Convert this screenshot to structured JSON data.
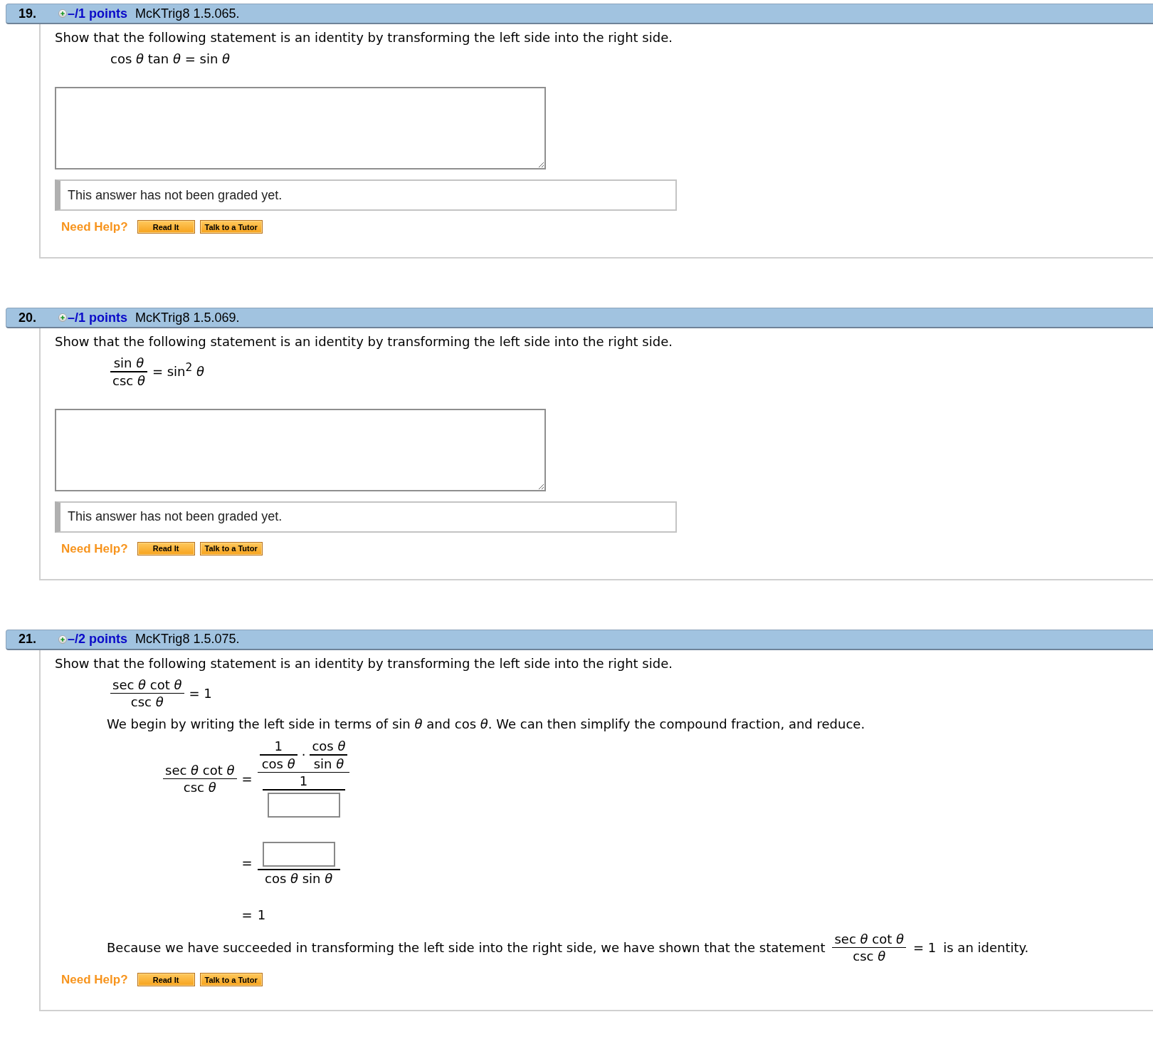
{
  "questions": [
    {
      "number": "19.",
      "points": "–/1 points",
      "source": "McKTrig8 1.5.065.",
      "prompt": "Show that the following statement is an identity by transforming the left side into the right side.",
      "statement": [
        {
          "kind": "text",
          "text": "cos *θ* tan *θ* = sin *θ*"
        }
      ],
      "answer": {
        "kind": "essay"
      },
      "grading_note": "This answer has not been graded yet.",
      "help": {
        "label": "Need Help?",
        "buttons": [
          "Read It",
          "Talk to a Tutor"
        ]
      }
    },
    {
      "number": "20.",
      "points": "–/1 points",
      "source": "McKTrig8 1.5.069.",
      "prompt": "Show that the following statement is an identity by transforming the left side into the right side.",
      "statement": [
        {
          "kind": "frac",
          "num": [
            {
              "kind": "text",
              "text": "sin *θ*"
            }
          ],
          "den": [
            {
              "kind": "text",
              "text": "csc *θ*"
            }
          ]
        },
        {
          "kind": "text",
          "text": "= sin$^{2}$ *θ*"
        }
      ],
      "answer": {
        "kind": "essay"
      },
      "grading_note": "This answer has not been graded yet.",
      "help": {
        "label": "Need Help?",
        "buttons": [
          "Read It",
          "Talk to a Tutor"
        ]
      }
    },
    {
      "number": "21.",
      "points": "–/2 points",
      "source": "McKTrig8 1.5.075.",
      "prompt": "Show that the following statement is an identity by transforming the left side into the right side.",
      "statement": [
        {
          "kind": "frac",
          "num": [
            {
              "kind": "text",
              "text": "sec *θ* cot *θ*"
            }
          ],
          "den": [
            {
              "kind": "text",
              "text": "csc *θ*"
            }
          ]
        },
        {
          "kind": "text",
          "text": "= 1"
        }
      ],
      "explanation": "We begin by writing the left side in terms of sin *θ* and cos *θ*. We can then simplify the compound fraction, and reduce.",
      "derivation": [
        {
          "lhs": [
            {
              "kind": "frac",
              "num": [
                {
                  "kind": "text",
                  "text": "sec *θ* cot *θ*"
                }
              ],
              "den": [
                {
                  "kind": "text",
                  "text": "csc *θ*"
                }
              ]
            }
          ],
          "relation": "=",
          "rhs": [
            {
              "kind": "frac",
              "num": [
                {
                  "kind": "frac",
                  "num": [
                    {
                      "kind": "text",
                      "text": "1"
                    }
                  ],
                  "den": [
                    {
                      "kind": "text",
                      "text": "cos *θ*"
                    }
                  ]
                },
                {
                  "kind": "text",
                  "text": "·"
                },
                {
                  "kind": "frac",
                  "num": [
                    {
                      "kind": "text",
                      "text": "cos *θ*"
                    }
                  ],
                  "den": [
                    {
                      "kind": "text",
                      "text": "sin *θ*"
                    }
                  ]
                }
              ],
              "den": [
                {
                  "kind": "frac",
                  "num": [
                    {
                      "kind": "text",
                      "text": "1"
                    }
                  ],
                  "den": [
                    {
                      "kind": "blank"
                    }
                  ]
                }
              ]
            }
          ]
        },
        {
          "relation": "=",
          "rhs": [
            {
              "kind": "frac",
              "num": [
                {
                  "kind": "blank"
                }
              ],
              "den": [
                {
                  "kind": "text",
                  "text": "cos *θ* sin *θ*"
                }
              ]
            }
          ]
        },
        {
          "relation": "=",
          "rhs": [
            {
              "kind": "text",
              "text": "1"
            }
          ]
        }
      ],
      "conclusion": [
        {
          "kind": "prose",
          "text": "Because we have succeeded in transforming the left side into the right side, we have shown that the statement"
        },
        {
          "kind": "frac",
          "num": [
            {
              "kind": "text",
              "text": "sec *θ* cot *θ*"
            }
          ],
          "den": [
            {
              "kind": "text",
              "text": "csc *θ*"
            }
          ]
        },
        {
          "kind": "text",
          "text": "= 1"
        },
        {
          "kind": "prose",
          "text": "is an identity."
        }
      ],
      "help": {
        "label": "Need Help?",
        "buttons": [
          "Read It",
          "Talk to a Tutor"
        ]
      }
    }
  ]
}
